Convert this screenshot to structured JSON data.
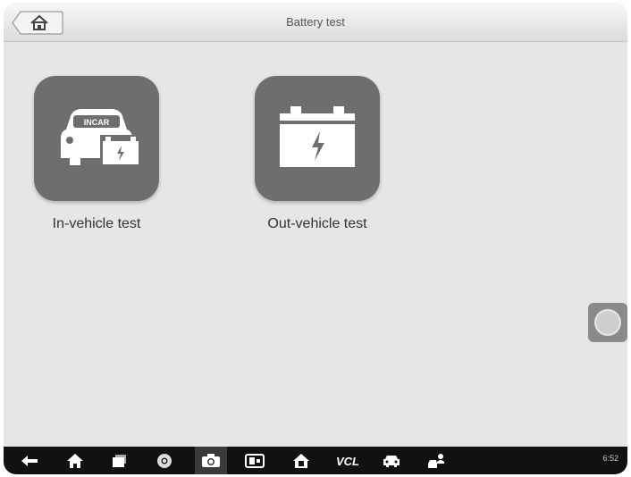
{
  "header": {
    "title": "Battery test",
    "home_icon": "home-icon"
  },
  "tiles": [
    {
      "label": "In-vehicle test",
      "icon": "incar-battery-icon",
      "car_badge": "INCAR"
    },
    {
      "label": "Out-vehicle test",
      "icon": "battery-icon"
    }
  ],
  "floating_button": {
    "icon": "assistive-touch-icon"
  },
  "navbar": {
    "icons": [
      "back-icon",
      "home-icon",
      "recent-apps-icon",
      "chrome-icon",
      "camera-icon",
      "screen-capture-icon",
      "diagnostic-home-icon",
      "vcl-icon",
      "car-icon",
      "user-car-icon"
    ],
    "vcl_label": "VCL",
    "status_text": "6:52"
  },
  "colors": {
    "background": "#e6e6e6",
    "tile": "#6e6e6e",
    "navbar": "#111111"
  }
}
